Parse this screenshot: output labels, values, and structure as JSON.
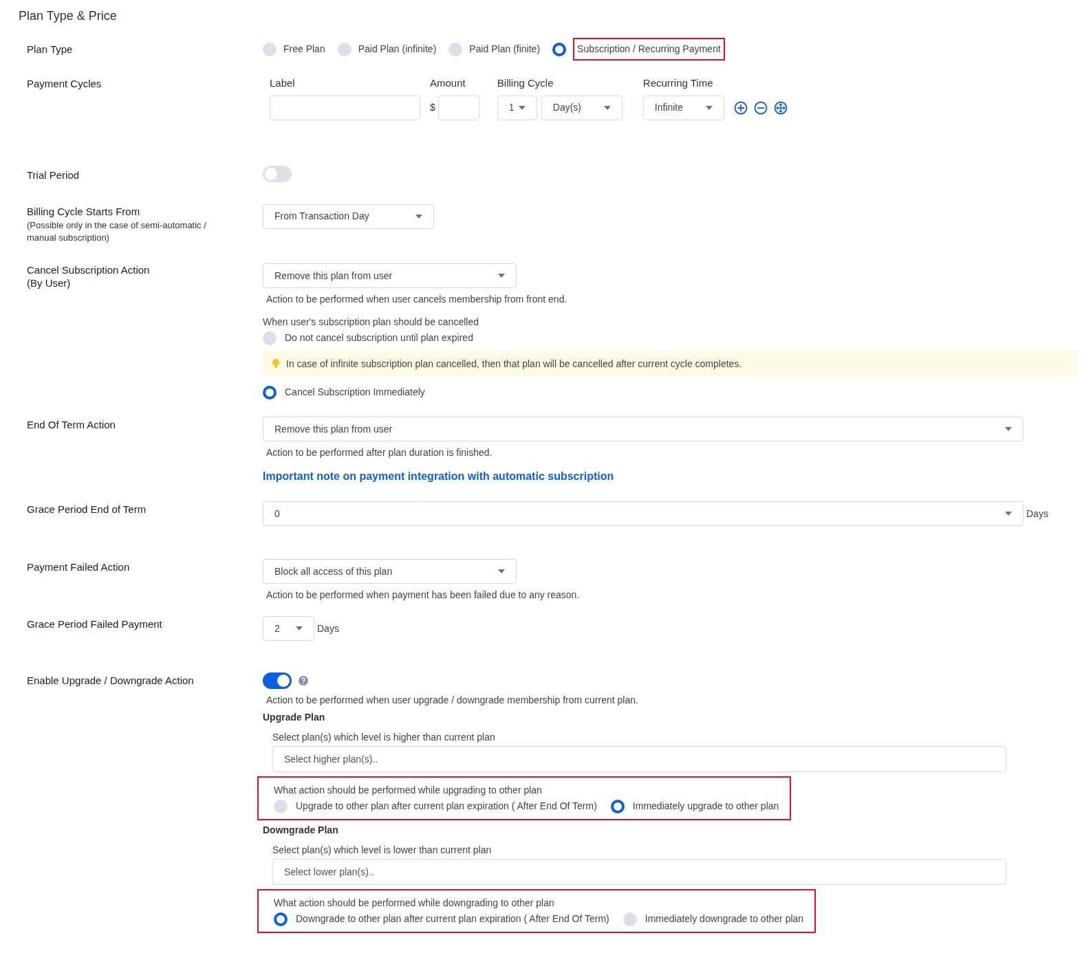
{
  "section_title": "Plan Type & Price",
  "plan_type": {
    "label": "Plan Type",
    "options": [
      {
        "label": "Free Plan",
        "selected": false,
        "highlighted": false
      },
      {
        "label": "Paid Plan (infinite)",
        "selected": false,
        "highlighted": false
      },
      {
        "label": "Paid Plan (finite)",
        "selected": false,
        "highlighted": false
      },
      {
        "label": "Subscription / Recurring Payment",
        "selected": true,
        "highlighted": true
      }
    ]
  },
  "payment_cycles": {
    "label": "Payment Cycles",
    "col_label": "Label",
    "col_amount": "Amount",
    "col_billing": "Billing Cycle",
    "col_recurring": "Recurring Time",
    "currency": "$",
    "billing_count": "1",
    "billing_unit": "Day(s)",
    "recurring_time": "Infinite"
  },
  "trial_period": {
    "label": "Trial Period",
    "on": false
  },
  "billing_start": {
    "label": "Billing Cycle Starts From",
    "note": "(Possible only in the case of semi-automatic / manual subscription)",
    "value": "From Transaction Day"
  },
  "cancel_action": {
    "label_lines": [
      "Cancel Subscription Action",
      "(By User)"
    ],
    "value": "Remove this plan from user",
    "help": "Action to be performed when user cancels membership from front end.",
    "when_label": "When user's subscription plan should be cancelled",
    "options": [
      {
        "label": "Do not cancel subscription until plan expired",
        "selected": false
      },
      {
        "label": "Cancel Subscription Immediately",
        "selected": true
      }
    ],
    "notice": "In case of infinite subscription plan cancelled, then that plan will be cancelled after current cycle completes."
  },
  "end_of_term": {
    "label": "End Of Term Action",
    "value": "Remove this plan from user",
    "help": "Action to be performed after plan duration is finished.",
    "link": "Important note on payment integration with automatic subscription"
  },
  "grace_end": {
    "label": "Grace Period End of Term",
    "value": "0",
    "unit": "Days"
  },
  "payment_failed": {
    "label": "Payment Failed Action",
    "value": "Block all access of this plan",
    "help": "Action to be performed when payment has been failed due to any reason."
  },
  "grace_failed": {
    "label": "Grace Period Failed Payment",
    "value": "2",
    "unit": "Days"
  },
  "upgrade_downgrade": {
    "label": "Enable Upgrade / Downgrade Action",
    "on": true,
    "help": "Action to be performed when user upgrade / downgrade membership from current plan.",
    "sections": [
      {
        "title": "Upgrade Plan",
        "select_label": "Select plan(s) which level is higher than current plan",
        "placeholder": "Select higher plan(s)..",
        "question": "What action should be performed while upgrading to other plan",
        "highlighted": true,
        "options": [
          {
            "label": "Upgrade to other plan after current plan expiration ( After End Of Term)",
            "selected": false
          },
          {
            "label": "Immediately upgrade to other plan",
            "selected": true
          }
        ]
      },
      {
        "title": "Downgrade Plan",
        "select_label": "Select plan(s) which level is lower than current plan",
        "placeholder": "Select lower plan(s)..",
        "question": "What action should be performed while downgrading to other plan",
        "highlighted": true,
        "options": [
          {
            "label": "Downgrade to other plan after current plan expiration ( After End Of Term)",
            "selected": true
          },
          {
            "label": "Immediately downgrade to other plan",
            "selected": false
          }
        ]
      }
    ]
  }
}
